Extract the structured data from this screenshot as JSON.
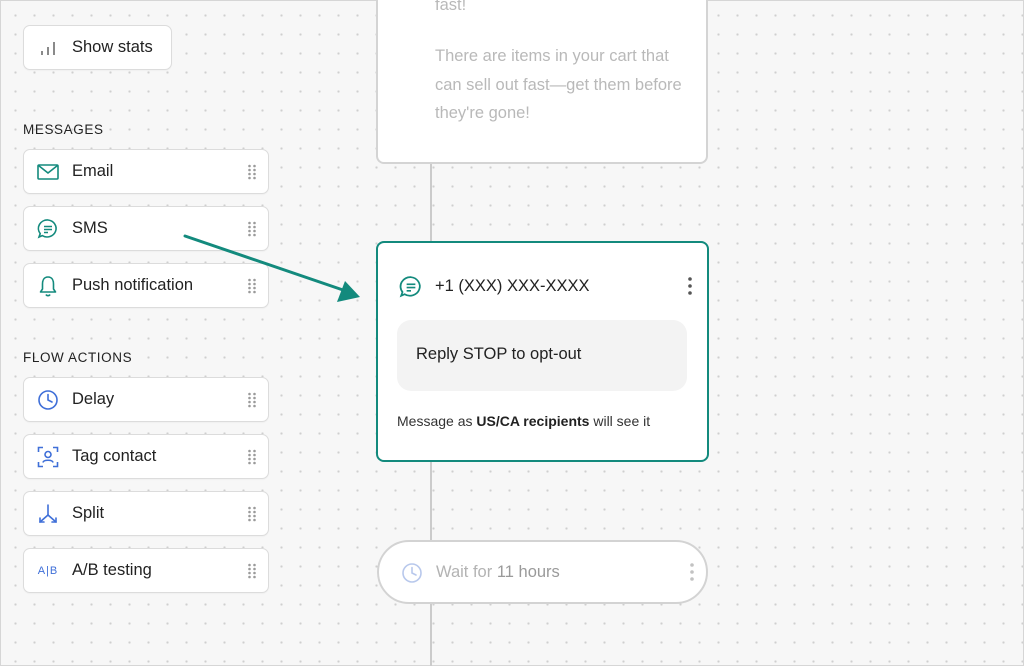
{
  "stats": {
    "label": "Show stats"
  },
  "sections": {
    "messages": "MESSAGES",
    "flow_actions": "FLOW ACTIONS"
  },
  "messages": [
    {
      "label": "Email",
      "icon": "email-icon"
    },
    {
      "label": "SMS",
      "icon": "sms-icon"
    },
    {
      "label": "Push notification",
      "icon": "bell-icon"
    }
  ],
  "flow_actions": [
    {
      "label": "Delay",
      "icon": "clock-icon"
    },
    {
      "label": "Tag contact",
      "icon": "tag-contact-icon"
    },
    {
      "label": "Split",
      "icon": "split-icon"
    },
    {
      "label": "A/B testing",
      "icon": "ab-testing-icon",
      "icon_text": "A|B"
    }
  ],
  "previous_message": {
    "line1": "fast!",
    "body": "There are items in your cart that can sell out fast—get them before they're gone!"
  },
  "sms_card": {
    "phone": "+1 (XXX) XXX-XXXX",
    "message": "Reply STOP to opt-out",
    "note_prefix": "Message as ",
    "note_bold": "US/CA recipients",
    "note_suffix": " will see it"
  },
  "wait_step": {
    "prefix": "Wait for ",
    "bold": "11 hours"
  },
  "colors": {
    "accent": "#138a7d",
    "action_blue": "#3f6fd8"
  }
}
